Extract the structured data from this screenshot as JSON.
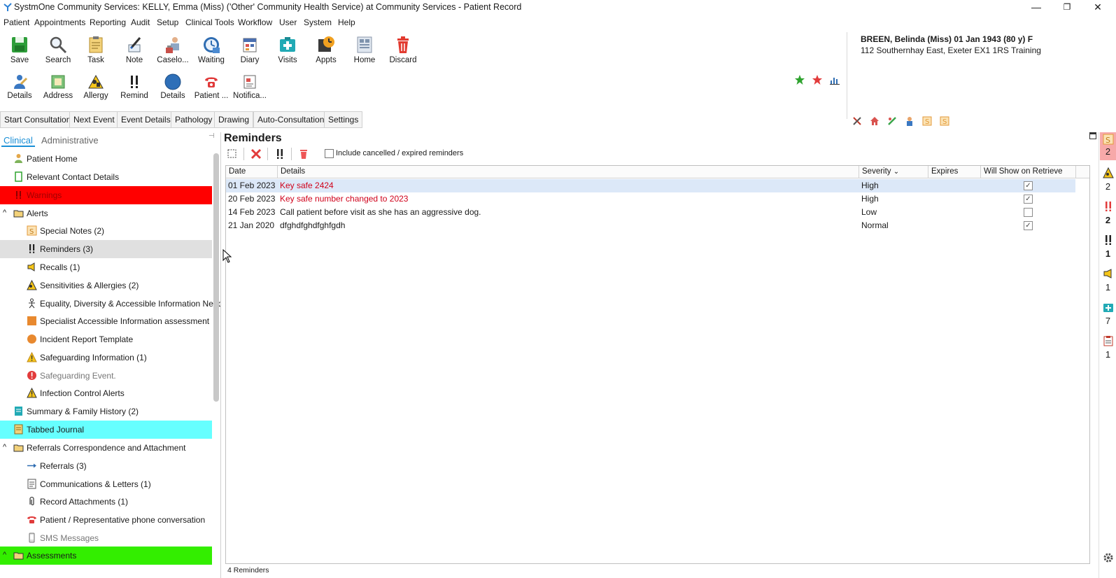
{
  "window": {
    "title": "SystmOne Community Services: KELLY, Emma (Miss) ('Other' Community Health Service) at Community Services - Patient Record",
    "minimize": "—",
    "restore": "❐",
    "close": "✕"
  },
  "menu": [
    "Patient",
    "Appointments",
    "Reporting",
    "Audit",
    "Setup",
    "Clinical Tools",
    "Workflow",
    "User",
    "System",
    "Help"
  ],
  "toolbar_row1": [
    "Save",
    "Search",
    "Task",
    "Note",
    "Caselo...",
    "Waiting",
    "Diary",
    "Visits",
    "Appts",
    "Home",
    "Discard"
  ],
  "toolbar_row2": [
    "Details",
    "Address",
    "Allergy",
    "Remind",
    "Details",
    "Patient ...",
    "Notifica..."
  ],
  "patient": {
    "name_line": "BREEN, Belinda (Miss) 01 Jan 1943 (80 y) F",
    "address_line": "112 Southernhay East, Exeter EX1 1RS  Training"
  },
  "action_buttons": [
    "Start Consultation",
    "Next Event",
    "Event Details",
    "Pathology",
    "Drawing",
    "Auto-Consultation",
    "Settings"
  ],
  "nav": {
    "tabs": [
      "Clinical",
      "Administrative"
    ],
    "items": [
      {
        "label": "Patient Home"
      },
      {
        "label": "Relevant Contact Details"
      },
      {
        "label": "Warnings"
      },
      {
        "label": "Alerts"
      },
      {
        "label": "Special Notes (2)"
      },
      {
        "label": "Reminders (3)"
      },
      {
        "label": "Recalls (1)"
      },
      {
        "label": "Sensitivities & Allergies (2)"
      },
      {
        "label": "Equality, Diversity & Accessible Information Need."
      },
      {
        "label": "Specialist Accessible Information assessment"
      },
      {
        "label": "Incident Report Template"
      },
      {
        "label": "Safeguarding Information (1)"
      },
      {
        "label": "Safeguarding Event."
      },
      {
        "label": "Infection Control Alerts"
      },
      {
        "label": "Summary & Family History (2)"
      },
      {
        "label": "Tabbed Journal"
      },
      {
        "label": "Referrals Correspondence and Attachment"
      },
      {
        "label": "Referrals (3)"
      },
      {
        "label": "Communications & Letters (1)"
      },
      {
        "label": "Record Attachments (1)"
      },
      {
        "label": "Patient / Representative phone conversation"
      },
      {
        "label": "SMS Messages"
      },
      {
        "label": "Assessments"
      }
    ]
  },
  "reminders": {
    "title": "Reminders",
    "include_cancelled_label": "Include cancelled / expired reminders",
    "columns": [
      "Date",
      "Details",
      "Severity",
      "Expires",
      "Will Show on Retrieve"
    ],
    "sort_indicator": "⌄",
    "rows": [
      {
        "date": "01 Feb 2023",
        "details": "Key safe 2424",
        "severity": "High",
        "expires": "",
        "will_show": true
      },
      {
        "date": "20 Feb 2023",
        "details": "Key safe number changed to 2023",
        "severity": "High",
        "expires": "",
        "will_show": true
      },
      {
        "date": "14 Feb 2023",
        "details": "Call patient before visit as she has an aggressive dog.",
        "severity": "Low",
        "expires": "",
        "will_show": false
      },
      {
        "date": "21 Jan 2020",
        "details": "dfghdfghdfghfgdh",
        "severity": "Normal",
        "expires": "",
        "will_show": true
      }
    ],
    "status": "4 Reminders"
  },
  "right_strip": [
    "2",
    "2",
    "2",
    "1",
    "1",
    "7",
    "1"
  ],
  "colors": {
    "warnings_bg": "#ff0000",
    "journal_bg": "#66ffff",
    "assessments_bg": "#33ee00",
    "selected_row": "#dce8f8",
    "red_text": "#d0021b",
    "clinical_tab": "#1a8fd6"
  }
}
